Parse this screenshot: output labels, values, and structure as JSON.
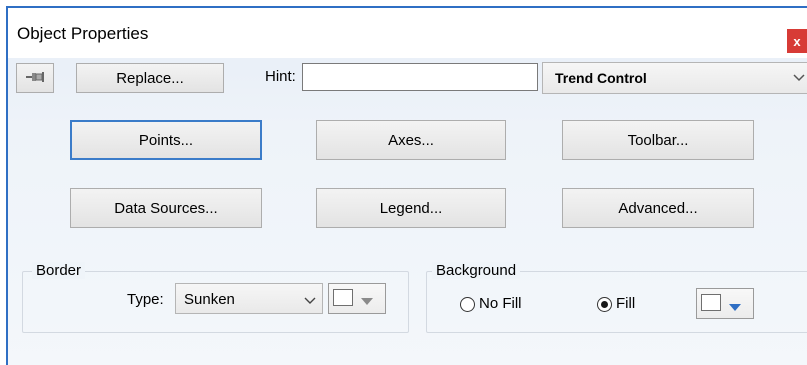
{
  "window": {
    "title": "Object Properties",
    "close_label": "x"
  },
  "toolbar": {
    "pin_icon": "pin-icon",
    "replace_label": "Replace...",
    "hint_label": "Hint:",
    "hint_value": "",
    "object_type": "Trend Control"
  },
  "buttons": {
    "points": "Points...",
    "axes": "Axes...",
    "toolbar": "Toolbar...",
    "data_sources": "Data Sources...",
    "legend": "Legend...",
    "advanced": "Advanced..."
  },
  "border": {
    "group_label": "Border",
    "type_label": "Type:",
    "type_value": "Sunken",
    "color": "#ffffff"
  },
  "background": {
    "group_label": "Background",
    "no_fill_label": "No Fill",
    "fill_label": "Fill",
    "selected": "Fill",
    "color": "#ffffff"
  },
  "colors": {
    "accent": "#2f6fc4",
    "close": "#d73b36",
    "focus": "#3b7cc9"
  }
}
